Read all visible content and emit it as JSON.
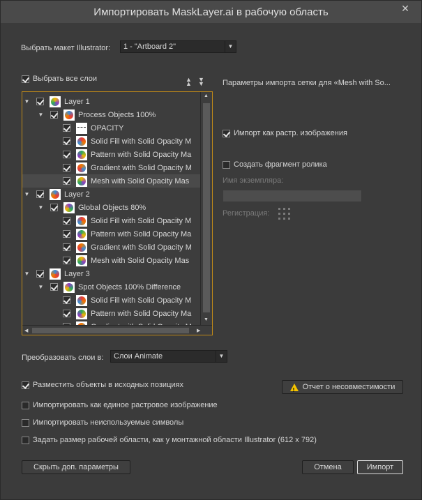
{
  "window": {
    "title": "Импортировать MaskLayer.ai в рабочую область",
    "close_label": "✕"
  },
  "artboard": {
    "label": "Выбрать макет Illustrator:",
    "value": "1 - \"Artboard 2\""
  },
  "select_all": {
    "label": "Выбрать все слои",
    "checked": true
  },
  "tree": {
    "rows": [
      {
        "label": "Layer 1",
        "level": 0,
        "triangle": "▼"
      },
      {
        "label": "Process Objects 100%",
        "level": 1,
        "triangle": "▼"
      },
      {
        "label": "OPACITY",
        "level": 2,
        "triangle": ""
      },
      {
        "label": "Solid Fill with Solid Opacity M",
        "level": 2,
        "triangle": ""
      },
      {
        "label": "Pattern with Solid Opacity Ma",
        "level": 2,
        "triangle": ""
      },
      {
        "label": "Gradient with Solid Opacity M",
        "level": 2,
        "triangle": ""
      },
      {
        "label": "Mesh with Solid Opacity Mas",
        "level": 2,
        "triangle": ""
      },
      {
        "label": "Layer 2",
        "level": 0,
        "triangle": "▼"
      },
      {
        "label": "Global Objects 80%",
        "level": 1,
        "triangle": "▼"
      },
      {
        "label": "Solid Fill with Solid Opacity M",
        "level": 2,
        "triangle": ""
      },
      {
        "label": "Pattern with Solid Opacity Ma",
        "level": 2,
        "triangle": ""
      },
      {
        "label": "Gradient with Solid Opacity M",
        "level": 2,
        "triangle": ""
      },
      {
        "label": "Mesh with Solid Opacity Mas",
        "level": 2,
        "triangle": ""
      },
      {
        "label": "Layer 3",
        "level": 0,
        "triangle": "▼"
      },
      {
        "label": "Spot Objects 100% Difference",
        "level": 1,
        "triangle": "▼"
      },
      {
        "label": "Solid Fill with Solid Opacity M",
        "level": 2,
        "triangle": ""
      },
      {
        "label": "Pattern with Solid Opacity Ma",
        "level": 2,
        "triangle": ""
      },
      {
        "label": "Gradient with Solid Opacity M",
        "level": 2,
        "triangle": ""
      }
    ],
    "selected_row_index": 6
  },
  "right_panel": {
    "heading": "Параметры импорта сетки для «Mesh with So...",
    "import_bitmap": {
      "label": "Импорт как растр. изображения",
      "checked": true
    },
    "create_movieclip": {
      "label": "Создать фрагмент ролика",
      "checked": false
    },
    "instance_name_label": "Имя экземпляра:",
    "registration_label": "Регистрация:"
  },
  "convert_layers": {
    "label": "Преобразовать слои в:",
    "value": "Слои Animate"
  },
  "options": [
    {
      "label": "Разместить объекты в исходных позициях",
      "checked": true
    },
    {
      "label": "Импортировать как единое растровое изображение",
      "checked": false
    },
    {
      "label": "Импортировать неиспользуемые символы",
      "checked": false
    },
    {
      "label": "Задать размер рабочей области, как у монтажной области Illustrator (612 x 792)",
      "checked": false
    }
  ],
  "buttons": {
    "incompatibility": "Отчет о несовместимости",
    "hide_advanced": "Скрыть доп. параметры",
    "cancel": "Отмена",
    "import": "Импорт"
  },
  "colors": {
    "accent_border": "#c08a18",
    "warning": "#f5c400"
  }
}
